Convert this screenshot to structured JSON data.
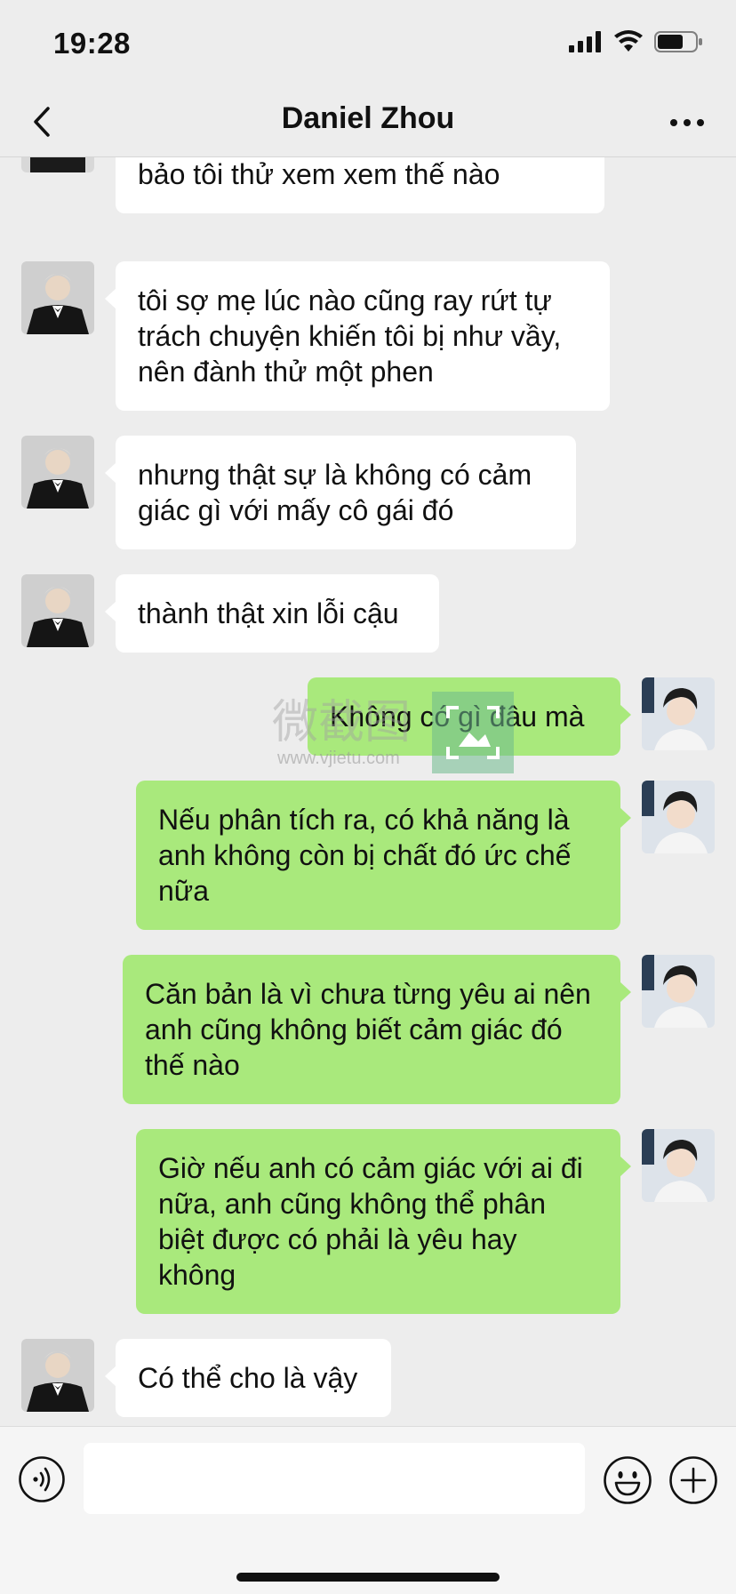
{
  "status": {
    "time": "19:28",
    "icons": [
      "cellular-signal-icon",
      "wifi-icon",
      "battery-icon"
    ]
  },
  "nav": {
    "title": "Daniel Zhou",
    "back_icon": "chevron-left-icon",
    "more_icon": "more-dots-icon"
  },
  "messages": [
    {
      "side": "in",
      "text": "đạo, có các anh phụ, nên mẹ hay bảo tôi thử xem xem thế nào"
    },
    {
      "side": "in",
      "text": "tôi sợ mẹ lúc nào cũng ray rứt tự trách chuyện khiến tôi bị như vầy, nên đành thử một phen"
    },
    {
      "side": "in",
      "text": "nhưng thật sự là không có cảm giác gì với mấy cô gái đó"
    },
    {
      "side": "in",
      "text": "thành thật xin lỗi cậu"
    },
    {
      "side": "out",
      "text": "Không có gì đâu mà"
    },
    {
      "side": "out",
      "text": "Nếu phân tích ra, có khả năng là anh không còn bị chất đó ức chế nữa"
    },
    {
      "side": "out",
      "text": "Căn bản là vì chưa từng yêu ai nên anh cũng không biết cảm giác đó thế nào"
    },
    {
      "side": "out",
      "text": "Giờ nếu anh có cảm giác với ai đi nữa, anh cũng không thể phân biệt được có phải là yêu hay không"
    },
    {
      "side": "in",
      "text": "Có thể cho là vậy"
    }
  ],
  "watermark": {
    "text": "微截图",
    "url": "www.vjietu.com"
  },
  "input": {
    "value": "",
    "placeholder": ""
  },
  "colors": {
    "background": "#ededed",
    "outgoing_bubble": "#a9e97c",
    "incoming_bubble": "#ffffff"
  }
}
